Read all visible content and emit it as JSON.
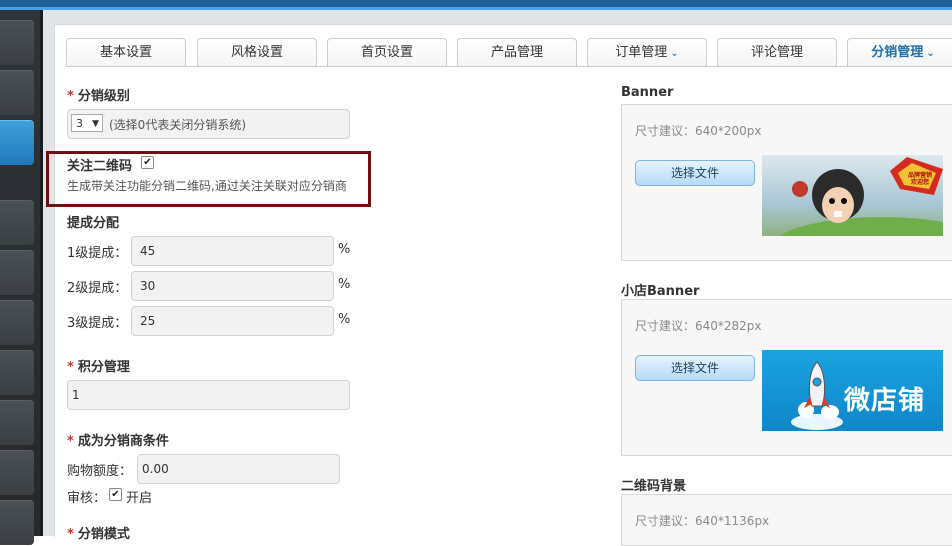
{
  "tabs": [
    {
      "label": "基本设置",
      "dropdown": false,
      "active": false
    },
    {
      "label": "风格设置",
      "dropdown": false,
      "active": false
    },
    {
      "label": "首页设置",
      "dropdown": false,
      "active": false
    },
    {
      "label": "产品管理",
      "dropdown": false,
      "active": false
    },
    {
      "label": "订单管理",
      "dropdown": true,
      "active": false
    },
    {
      "label": "评论管理",
      "dropdown": false,
      "active": false
    },
    {
      "label": "分销管理",
      "dropdown": true,
      "active": true
    }
  ],
  "distribution_level": {
    "label": "分销级别",
    "selected": "3",
    "hint": "(选择0代表关闭分销系统)"
  },
  "follow_qrcode": {
    "label": "关注二维码",
    "checked": true,
    "description": "生成带关注功能分销二维码,通过关注关联对应分销商"
  },
  "commission": {
    "label": "提成分配",
    "rows": [
      {
        "label": "1级提成：",
        "value": "45",
        "unit": "%"
      },
      {
        "label": "2级提成：",
        "value": "30",
        "unit": "%"
      },
      {
        "label": "3级提成：",
        "value": "25",
        "unit": "%"
      }
    ]
  },
  "points": {
    "label": "积分管理",
    "value": "1"
  },
  "condition": {
    "label": "成为分销商条件",
    "amount_label": "购物额度：",
    "amount_value": "0.00",
    "review_label": "审核：",
    "review_checked": true,
    "review_text": "开启"
  },
  "mode": {
    "label": "分销模式"
  },
  "banner": {
    "title": "Banner",
    "hint": "尺寸建议：640*200px",
    "button": "选择文件",
    "image_text": "品牌营销 欢迎您"
  },
  "shop_banner": {
    "title": "小店Banner",
    "hint": "尺寸建议：640*282px",
    "button": "选择文件",
    "image_text": "微店铺"
  },
  "qrcode_bg": {
    "title": "二维码背景",
    "hint": "尺寸建议：640*1136px"
  },
  "colors": {
    "accent": "#1f6fa8",
    "highlight_border": "#6e0f14",
    "required": "#c0392b"
  }
}
